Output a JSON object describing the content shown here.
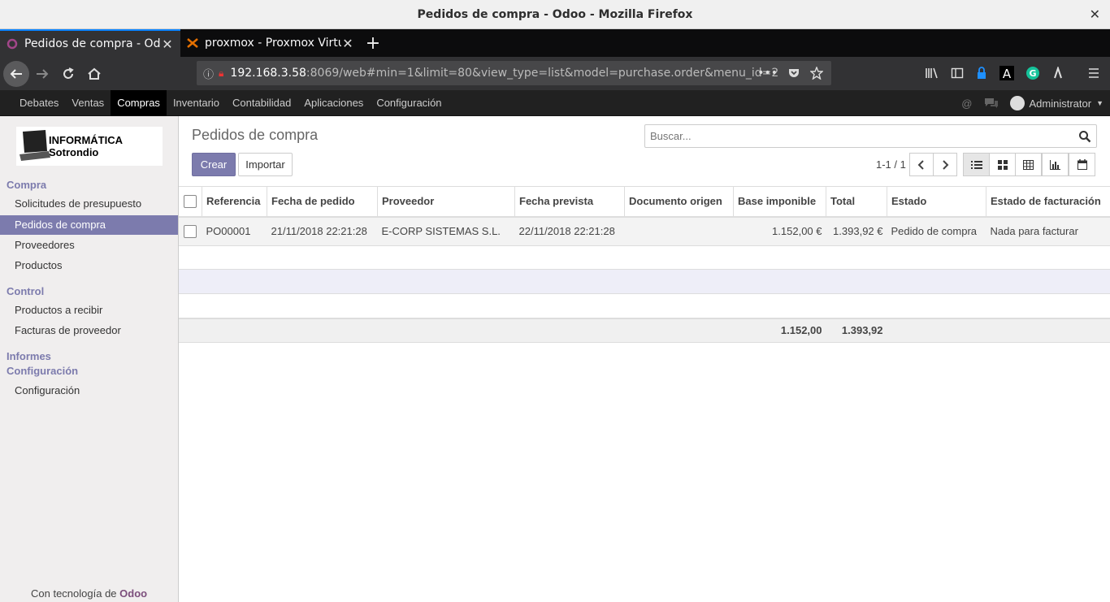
{
  "window": {
    "title": "Pedidos de compra - Odoo - Mozilla Firefox"
  },
  "tabs": [
    {
      "label": "Pedidos de compra - Odoo"
    },
    {
      "label": "proxmox - Proxmox Virtual Environment"
    }
  ],
  "url": {
    "host": "192.168.3.58",
    "rest": ":8069/web#min=1&limit=80&view_type=list&model=purchase.order&menu_id=2"
  },
  "topmenu": [
    "Debates",
    "Ventas",
    "Compras",
    "Inventario",
    "Contabilidad",
    "Aplicaciones",
    "Configuración"
  ],
  "user": {
    "name": "Administrator"
  },
  "logo": {
    "text": "INFORMÁTICA Sotrondio"
  },
  "sidebar": {
    "compra": "Compra",
    "compra_items": [
      "Solicitudes de presupuesto",
      "Pedidos de compra",
      "Proveedores",
      "Productos"
    ],
    "control": "Control",
    "control_items": [
      "Productos a recibir",
      "Facturas de proveedor"
    ],
    "informes": "Informes",
    "configuracion": "Configuración",
    "config_items": [
      "Configuración"
    ]
  },
  "powered": {
    "prefix": "Con tecnología de",
    "brand": "Odoo"
  },
  "main": {
    "breadcrumb": "Pedidos de compra",
    "search_placeholder": "Buscar...",
    "create": "Crear",
    "import": "Importar",
    "pager": "1-1 / 1"
  },
  "table": {
    "headers": [
      "Referencia",
      "Fecha de pedido",
      "Proveedor",
      "Fecha prevista",
      "Documento origen",
      "Base imponible",
      "Total",
      "Estado",
      "Estado de facturación"
    ],
    "rows": [
      [
        "PO00001",
        "21/11/2018 22:21:28",
        "E-CORP SISTEMAS S.L.",
        "22/11/2018 22:21:28",
        "",
        "1.152,00 €",
        "1.393,92 €",
        "Pedido de compra",
        "Nada para facturar"
      ]
    ],
    "totals": {
      "base": "1.152,00",
      "total": "1.393,92"
    }
  },
  "colors": {
    "accent": "#7c7bad",
    "topbar": "#212121"
  }
}
